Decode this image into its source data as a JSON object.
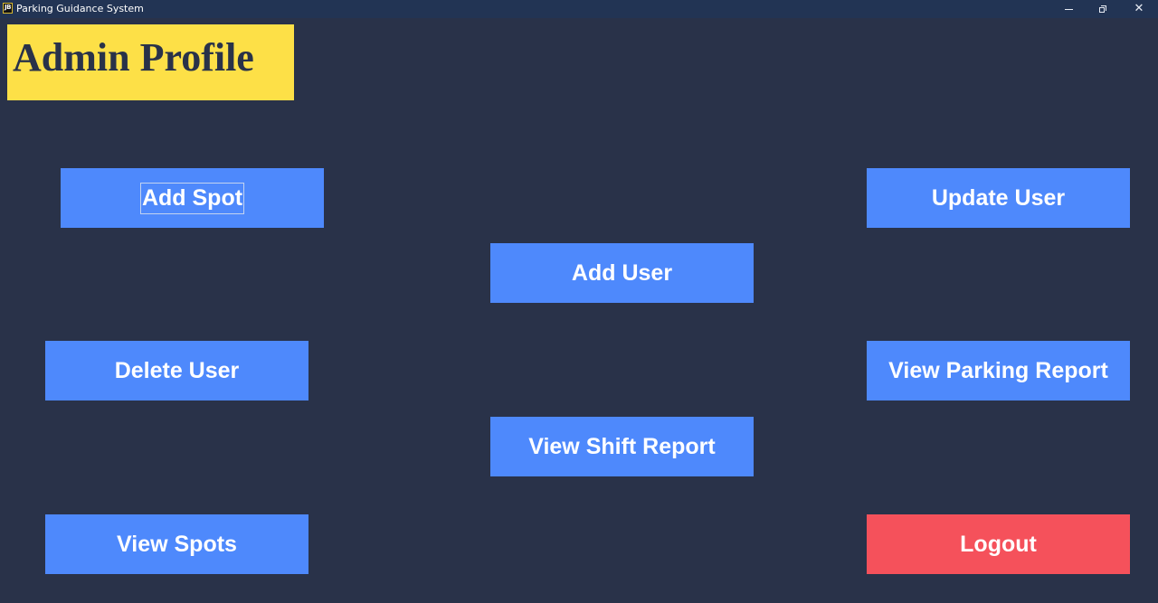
{
  "window": {
    "icon_label": "JB",
    "title": "Parking Guidance System",
    "controls": {
      "minimize": "minimize-icon",
      "restore": "restore-icon",
      "close": "✕"
    }
  },
  "header": {
    "title": "Admin Profile"
  },
  "buttons": {
    "add_spot": "Add Spot",
    "update_user": "Update User",
    "add_user": "Add User",
    "delete_user": "Delete User",
    "view_parking_report": "View Parking Report",
    "view_shift_report": "View Shift Report",
    "view_spots": "View Spots",
    "logout": "Logout"
  },
  "colors": {
    "background": "#293249",
    "titlebar": "#223454",
    "heading_box": "#fde047",
    "button": "#4e89fc",
    "logout": "#f5515b"
  }
}
